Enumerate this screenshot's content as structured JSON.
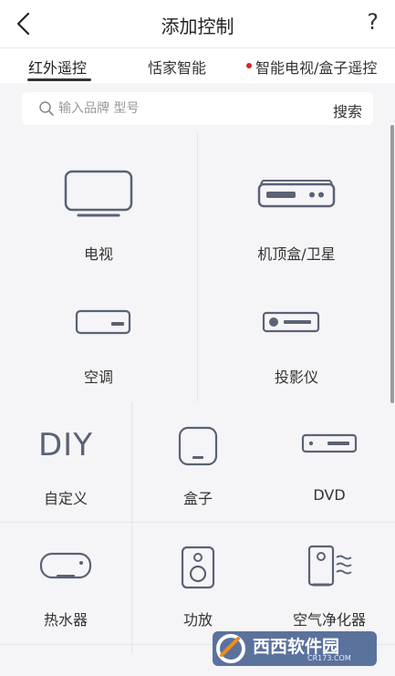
{
  "header": {
    "title": "添加控制",
    "help": "?"
  },
  "tabs": [
    {
      "label": "红外遥控",
      "active": true
    },
    {
      "label": "恬家智能",
      "active": false
    },
    {
      "label": "智能电视/盒子遥控",
      "active": false,
      "dot_color": "#d22222"
    }
  ],
  "search": {
    "placeholder": "输入品牌 型号",
    "button_label": "搜索"
  },
  "devices_top": [
    {
      "label": "电视",
      "icon": "tv-icon"
    },
    {
      "label": "机顶盒/卫星",
      "icon": "set-top-box-icon"
    },
    {
      "label": "空调",
      "icon": "air-conditioner-icon"
    },
    {
      "label": "投影仪",
      "icon": "projector-icon"
    }
  ],
  "devices_bottom": [
    {
      "label": "自定义",
      "icon": "diy-icon",
      "icon_text": "DIY"
    },
    {
      "label": "盒子",
      "icon": "box-icon"
    },
    {
      "label": "DVD",
      "icon": "dvd-icon"
    },
    {
      "label": "热水器",
      "icon": "water-heater-icon"
    },
    {
      "label": "功放",
      "icon": "amplifier-icon"
    },
    {
      "label": "空气净化器",
      "icon": "air-purifier-icon"
    }
  ],
  "watermark": {
    "text": "西西软件园",
    "subtext": "CR173.COM"
  },
  "colors": {
    "icon_stroke": "#5a6275",
    "background": "#f5f5f7",
    "accent_dot": "#d22222"
  }
}
